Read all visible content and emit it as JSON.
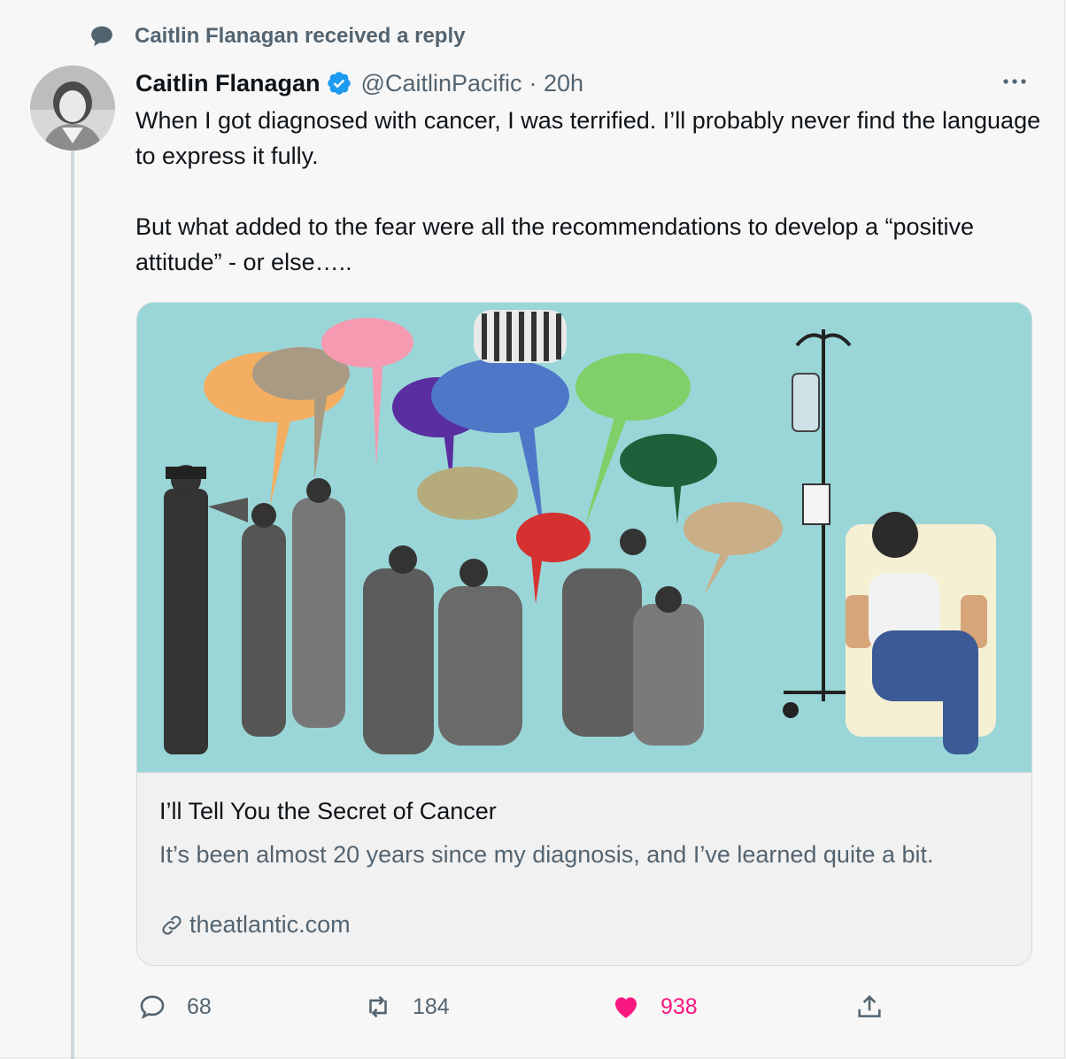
{
  "context": {
    "label": "Caitlin Flanagan received a reply"
  },
  "tweet": {
    "author_name": "Caitlin Flanagan",
    "handle": "@CaitlinPacific",
    "time": "· 20h",
    "text": "When I got diagnosed with cancer, I was terrified. I’ll probably never find the language to express it fully.\n\nBut what added to the fear were all the recommendations to develop a “positive attitude” - or else….."
  },
  "card": {
    "title": "I’ll Tell You the Secret of Cancer",
    "description": "It’s been almost 20 years since my diagnosis, and I’ve learned quite a bit.",
    "domain": "theatlantic.com"
  },
  "actions": {
    "reply_count": "68",
    "retweet_count": "184",
    "like_count": "938"
  },
  "colors": {
    "accent": "#1d9bf0",
    "like": "#f91880",
    "muted": "#536471",
    "card_bg": "#9ad6d8"
  }
}
